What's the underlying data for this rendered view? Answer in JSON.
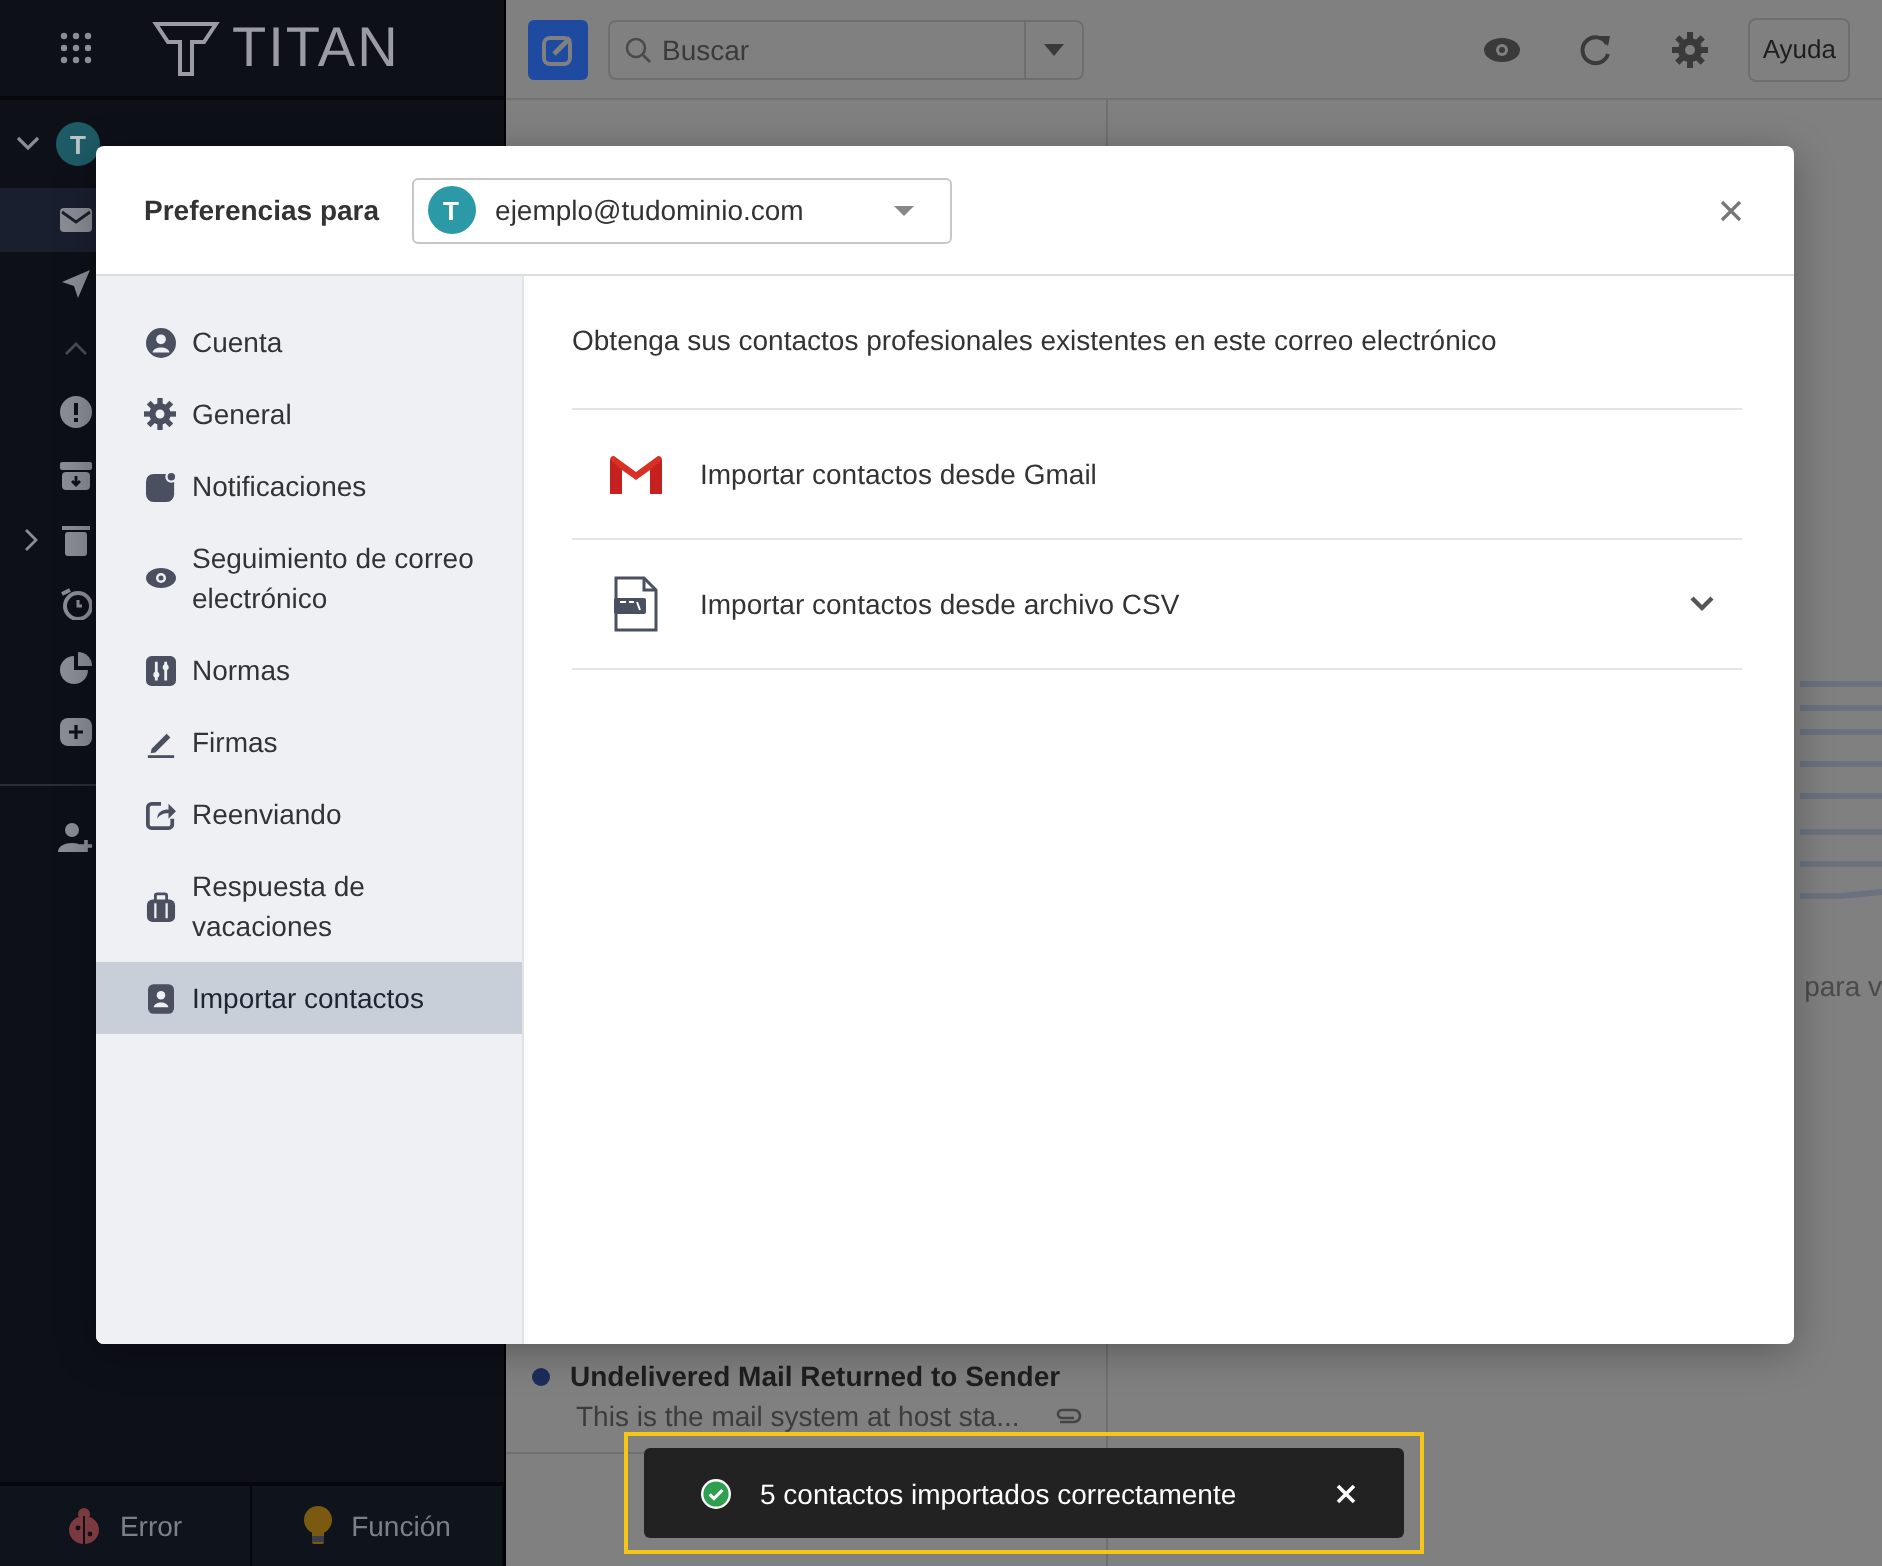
{
  "app": {
    "logo": "TITAN",
    "account_avatar": "T",
    "search": {
      "placeholder": "Buscar"
    },
    "help_button": "Ayuda",
    "sidebar_footer": [
      {
        "label": "Error",
        "kind": "bug"
      },
      {
        "label": "Función",
        "kind": "bulb"
      }
    ],
    "message_list": [
      {
        "subject": "Undelivered Mail Returned to Sender",
        "preview": "This is the mail system at host sta...",
        "unread": true,
        "attachment": true
      }
    ],
    "reading_pane_text": "para v"
  },
  "modal": {
    "title": "Preferencias para",
    "account": {
      "avatar": "T",
      "email": "ejemplo@tudominio.com"
    },
    "menu": [
      {
        "label": "Cuenta",
        "kind": "account",
        "selected": false
      },
      {
        "label": "General",
        "kind": "general",
        "selected": false
      },
      {
        "label": "Notificaciones",
        "kind": "notifications",
        "selected": false
      },
      {
        "label": "Seguimiento de correo electrónico",
        "kind": "tracking",
        "selected": false
      },
      {
        "label": "Normas",
        "kind": "rules",
        "selected": false
      },
      {
        "label": "Firmas",
        "kind": "signatures",
        "selected": false
      },
      {
        "label": "Reenviando",
        "kind": "forwarding",
        "selected": false
      },
      {
        "label": "Respuesta de vacaciones",
        "kind": "vacation",
        "selected": false
      },
      {
        "label": "Importar contactos",
        "kind": "import",
        "selected": true
      }
    ],
    "description": "Obtenga sus contactos profesionales existentes en este correo electrónico",
    "options": [
      {
        "label": "Importar contactos desde Gmail",
        "kind": "gmail",
        "expandable": false
      },
      {
        "label": "Importar contactos desde archivo CSV",
        "kind": "csv",
        "expandable": true
      }
    ]
  },
  "toast": {
    "message": "5 contactos importados correctamente",
    "kind": "success",
    "highlighted": true
  }
}
